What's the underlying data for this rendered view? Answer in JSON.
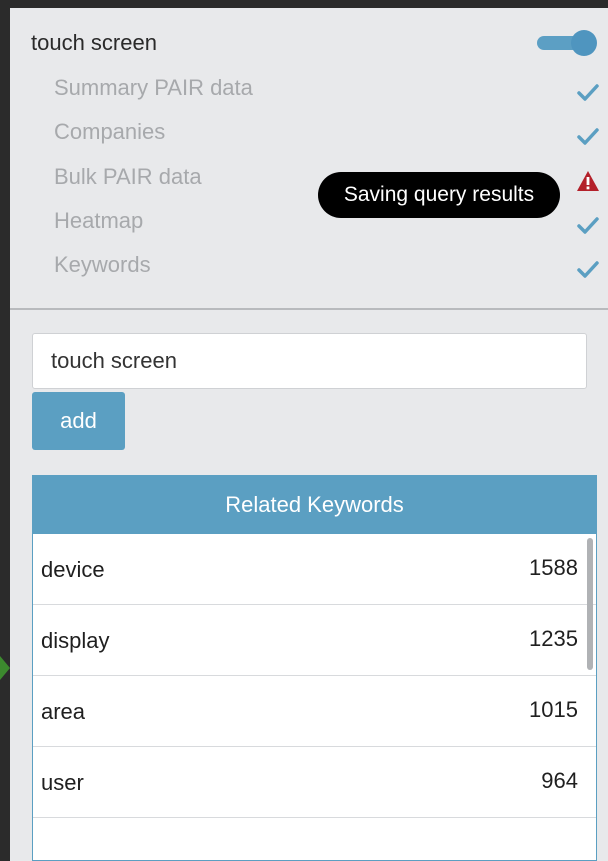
{
  "header": {
    "query": "touch screen",
    "toggle_on": true
  },
  "status_items": [
    {
      "label": "Summary PAIR data",
      "status": "check-icon"
    },
    {
      "label": "Companies",
      "status": "check-icon"
    },
    {
      "label": "Bulk PAIR data",
      "status": "warning-icon"
    },
    {
      "label": "Heatmap",
      "status": "check-icon"
    },
    {
      "label": "Keywords",
      "status": "check-icon"
    }
  ],
  "tooltip": {
    "text": "Saving query results"
  },
  "search": {
    "value": "touch screen",
    "placeholder": ""
  },
  "add_button": {
    "label": "add"
  },
  "keywords": {
    "title": "Related Keywords",
    "rows": [
      {
        "keyword": "device",
        "count": "1588"
      },
      {
        "keyword": "display",
        "count": "1235"
      },
      {
        "keyword": "area",
        "count": "1015"
      },
      {
        "keyword": "user",
        "count": "964"
      },
      {
        "keyword": "",
        "count": ""
      }
    ]
  },
  "colors": {
    "accent": "#5b9fc2",
    "check": "#5b9fc2",
    "warning": "#b3202a",
    "panel": "#e8e9eb"
  }
}
